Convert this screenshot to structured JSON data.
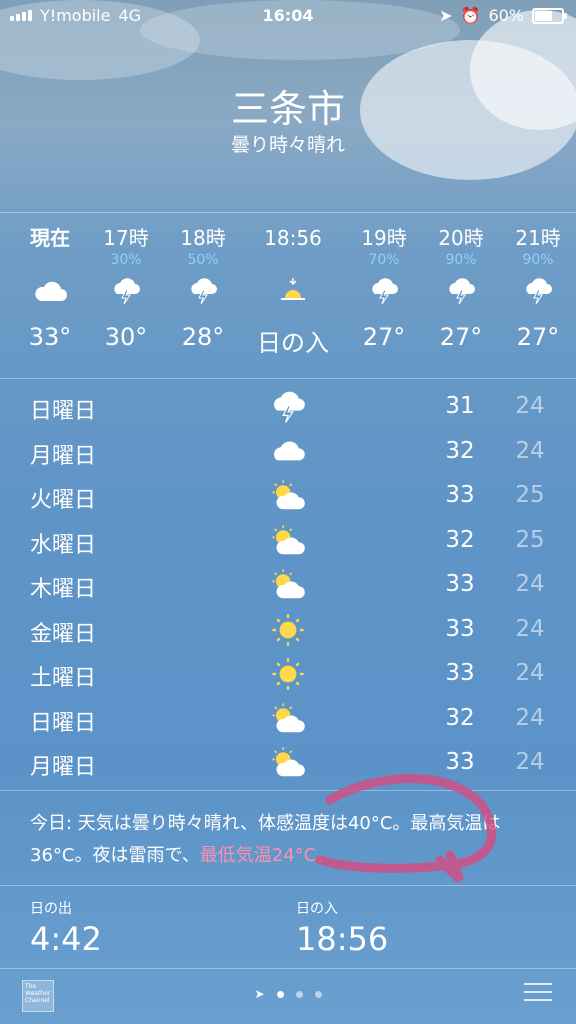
{
  "status": {
    "carrier": "Y!mobile",
    "network": "4G",
    "time": "16:04",
    "battery": "60%"
  },
  "location": {
    "city": "三条市",
    "condition": "曇り時々晴れ"
  },
  "hourly": [
    {
      "time": "現在",
      "pop": "",
      "icon": "cloud-icon",
      "temp": "33°"
    },
    {
      "time": "17時",
      "pop": "30%",
      "icon": "thunderstorm-icon",
      "temp": "30°"
    },
    {
      "time": "18時",
      "pop": "50%",
      "icon": "thunderstorm-icon",
      "temp": "28°"
    },
    {
      "time": "18:56",
      "pop": "",
      "icon": "sunset-icon",
      "temp": "日の入"
    },
    {
      "time": "19時",
      "pop": "70%",
      "icon": "thunderstorm-icon",
      "temp": "27°"
    },
    {
      "time": "20時",
      "pop": "90%",
      "icon": "thunderstorm-icon",
      "temp": "27°"
    },
    {
      "time": "21時",
      "pop": "90%",
      "icon": "thunderstorm-icon",
      "temp": "27°"
    }
  ],
  "daily": [
    {
      "day": "日曜日",
      "icon": "thunderstorm-icon",
      "high": "31",
      "low": "24"
    },
    {
      "day": "月曜日",
      "icon": "cloud-icon",
      "high": "32",
      "low": "24"
    },
    {
      "day": "火曜日",
      "icon": "partly-cloudy-icon",
      "high": "33",
      "low": "25"
    },
    {
      "day": "水曜日",
      "icon": "partly-cloudy-icon",
      "high": "32",
      "low": "25"
    },
    {
      "day": "木曜日",
      "icon": "partly-cloudy-icon",
      "high": "33",
      "low": "24"
    },
    {
      "day": "金曜日",
      "icon": "sun-icon",
      "high": "33",
      "low": "24"
    },
    {
      "day": "土曜日",
      "icon": "sun-icon",
      "high": "33",
      "low": "24"
    },
    {
      "day": "日曜日",
      "icon": "partly-cloudy-icon",
      "high": "32",
      "low": "24"
    },
    {
      "day": "月曜日",
      "icon": "partly-cloudy-icon",
      "high": "33",
      "low": "24"
    }
  ],
  "summary": {
    "part1": "今日: 天気は曇り時々晴れ、体感温度は40°C。最高気温は36°C。夜は雷雨で、",
    "part2": "最低気温24°C。"
  },
  "sun": {
    "sunrise_label": "日の出",
    "sunrise": "4:42",
    "sunset_label": "日の入",
    "sunset": "18:56"
  },
  "footer": {
    "logo_text": "The Weather Channel"
  },
  "colors": {
    "pop": "#8ed0ff",
    "annotation": "#e0457a",
    "sun": "#ffd84a"
  }
}
